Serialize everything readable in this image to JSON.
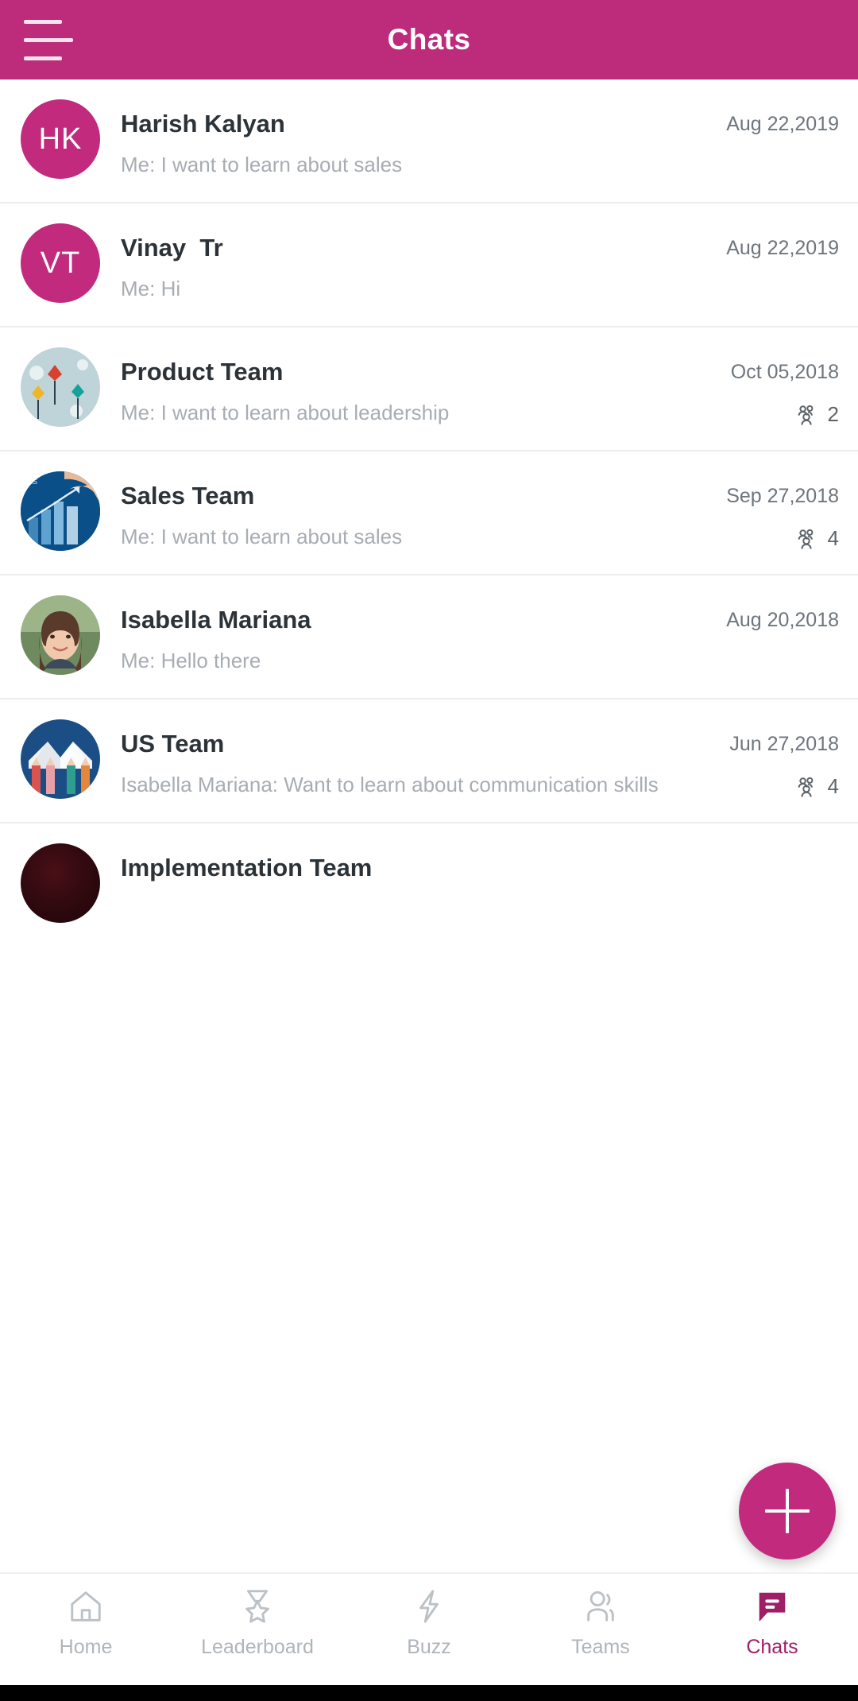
{
  "header": {
    "title": "Chats",
    "menu_icon": "hamburger-menu-icon",
    "background_color": "#bd2b7b"
  },
  "chats": [
    {
      "name": "Harish Kalyan",
      "message": "Me: I want to learn about sales",
      "date": "Aug 22,2019",
      "avatar_type": "initials",
      "initials": "HK",
      "members": null
    },
    {
      "name": "Vinay  Tr",
      "message": "Me: Hi",
      "date": "Aug 22,2019",
      "avatar_type": "initials",
      "initials": "VT",
      "members": null
    },
    {
      "name": "Product Team",
      "message": "Me: I want to learn about leadership",
      "date": "Oct 05,2018",
      "avatar_type": "image-kites",
      "initials": "",
      "members": "2"
    },
    {
      "name": "Sales Team",
      "message": "Me: I want to learn about sales",
      "date": "Sep 27,2018",
      "avatar_type": "image-chart",
      "initials": "",
      "members": "4"
    },
    {
      "name": "Isabella Mariana",
      "message": "Me: Hello there",
      "date": "Aug 20,2018",
      "avatar_type": "image-portrait",
      "initials": "",
      "members": null
    },
    {
      "name": "US Team",
      "message": "Isabella Mariana: Want to learn about communication skills",
      "date": "Jun 27,2018",
      "avatar_type": "image-pencils",
      "initials": "",
      "members": "4"
    },
    {
      "name": "Implementation Team",
      "message": "",
      "date": "",
      "avatar_type": "image-dark",
      "initials": "",
      "members": null
    }
  ],
  "fab": {
    "label": "+",
    "icon": "plus-icon",
    "color": "#c12a7d"
  },
  "bottom_nav": {
    "items": [
      {
        "label": "Home",
        "icon": "home-icon",
        "active": false
      },
      {
        "label": "Leaderboard",
        "icon": "medal-star-icon",
        "active": false
      },
      {
        "label": "Buzz",
        "icon": "lightning-icon",
        "active": false
      },
      {
        "label": "Teams",
        "icon": "people-icon",
        "active": false
      },
      {
        "label": "Chats",
        "icon": "chat-bubble-icon",
        "active": true
      }
    ],
    "active_color": "#9e1f66"
  }
}
